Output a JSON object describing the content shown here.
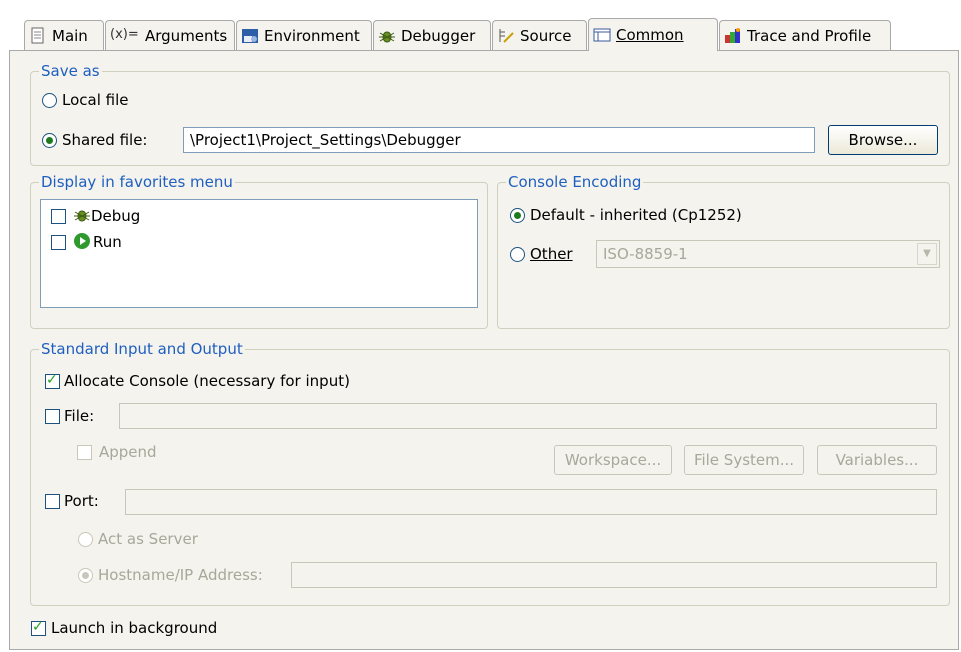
{
  "tabs": [
    {
      "label": "Main",
      "icon": "document-icon"
    },
    {
      "label": "Arguments",
      "icon": "arguments-icon",
      "prefix": "(x)="
    },
    {
      "label": "Environment",
      "icon": "environment-icon"
    },
    {
      "label": "Debugger",
      "icon": "bug-icon"
    },
    {
      "label": "Source",
      "icon": "source-icon"
    },
    {
      "label": "Common",
      "icon": "common-icon",
      "active": true
    },
    {
      "label": "Trace and Profile",
      "icon": "trace-profile-icon"
    }
  ],
  "save_as": {
    "legend": "Save as",
    "local_file": "Local file",
    "shared_file": "Shared file:",
    "shared_path": "\\Project1\\Project_Settings\\Debugger",
    "browse": "Browse...",
    "selected": "shared"
  },
  "favorites": {
    "legend": "Display in favorites menu",
    "items": [
      {
        "label": "Debug",
        "checked": false,
        "icon": "bug-icon"
      },
      {
        "label": "Run",
        "checked": false,
        "icon": "run-icon"
      }
    ]
  },
  "encoding": {
    "legend": "Console Encoding",
    "default_label": "Default - inherited (Cp1252)",
    "other_label": "Other",
    "other_value": "ISO-8859-1",
    "selected": "default"
  },
  "std_io": {
    "legend": "Standard Input and Output",
    "allocate_console": "Allocate Console (necessary for input)",
    "allocate_checked": true,
    "file_label": "File:",
    "file_checked": false,
    "file_value": "",
    "append_label": "Append",
    "workspace_btn": "Workspace...",
    "filesystem_btn": "File System...",
    "variables_btn": "Variables...",
    "port_label": "Port:",
    "port_checked": false,
    "port_value": "",
    "act_as_server": "Act as Server",
    "hostname_label": "Hostname/IP Address:",
    "hostname_value": ""
  },
  "launch_background": {
    "label": "Launch in background",
    "checked": true
  },
  "colors": {
    "legend": "#1f5fbf",
    "panel_bg": "#f4f3ee",
    "check_mark": "#21a121"
  }
}
